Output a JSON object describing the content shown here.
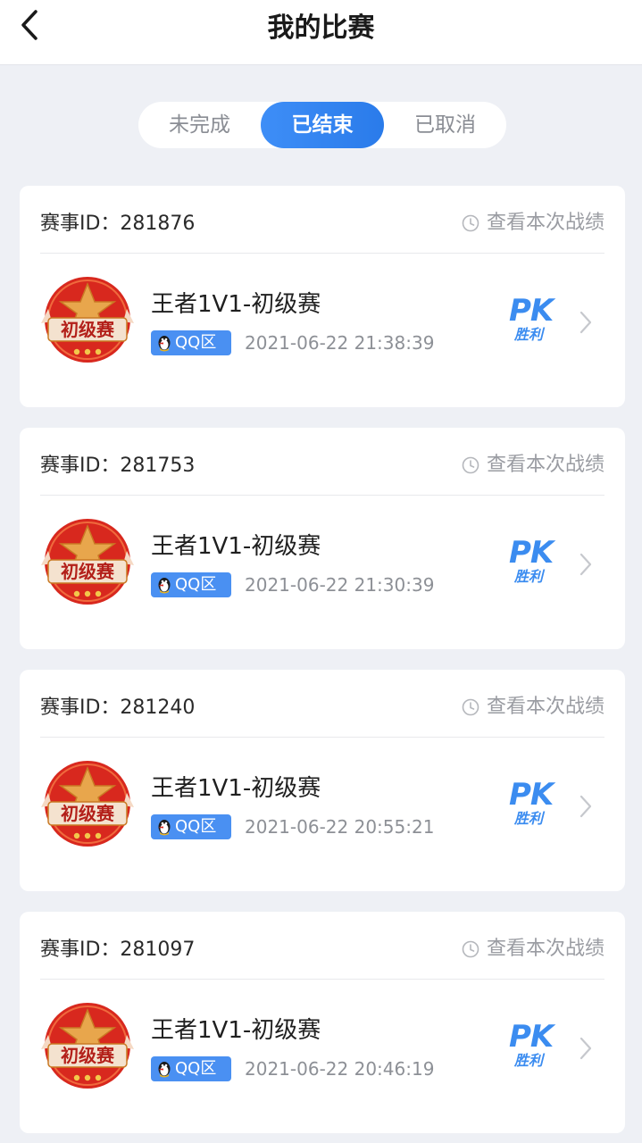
{
  "header": {
    "title": "我的比赛"
  },
  "tabs": [
    {
      "label": "未完成",
      "active": false
    },
    {
      "label": "已结束",
      "active": true
    },
    {
      "label": "已取消",
      "active": false
    }
  ],
  "matches": [
    {
      "event_id": "赛事ID：281876",
      "view_label": "查看本次战绩",
      "badge_text": "初级赛",
      "name": "王者1V1-初级赛",
      "zone": "QQ区",
      "time": "2021-06-22 21:38:39",
      "result_top": "PK",
      "result_bottom": "胜利"
    },
    {
      "event_id": "赛事ID：281753",
      "view_label": "查看本次战绩",
      "badge_text": "初级赛",
      "name": "王者1V1-初级赛",
      "zone": "QQ区",
      "time": "2021-06-22 21:30:39",
      "result_top": "PK",
      "result_bottom": "胜利"
    },
    {
      "event_id": "赛事ID：281240",
      "view_label": "查看本次战绩",
      "badge_text": "初级赛",
      "name": "王者1V1-初级赛",
      "zone": "QQ区",
      "time": "2021-06-22 20:55:21",
      "result_top": "PK",
      "result_bottom": "胜利"
    },
    {
      "event_id": "赛事ID：281097",
      "view_label": "查看本次战绩",
      "badge_text": "初级赛",
      "name": "王者1V1-初级赛",
      "zone": "QQ区",
      "time": "2021-06-22 20:46:19",
      "result_top": "PK",
      "result_bottom": "胜利"
    }
  ],
  "colors": {
    "accent": "#3b8cf0",
    "badge_red": "#d8281e",
    "background": "#eef0f5"
  }
}
